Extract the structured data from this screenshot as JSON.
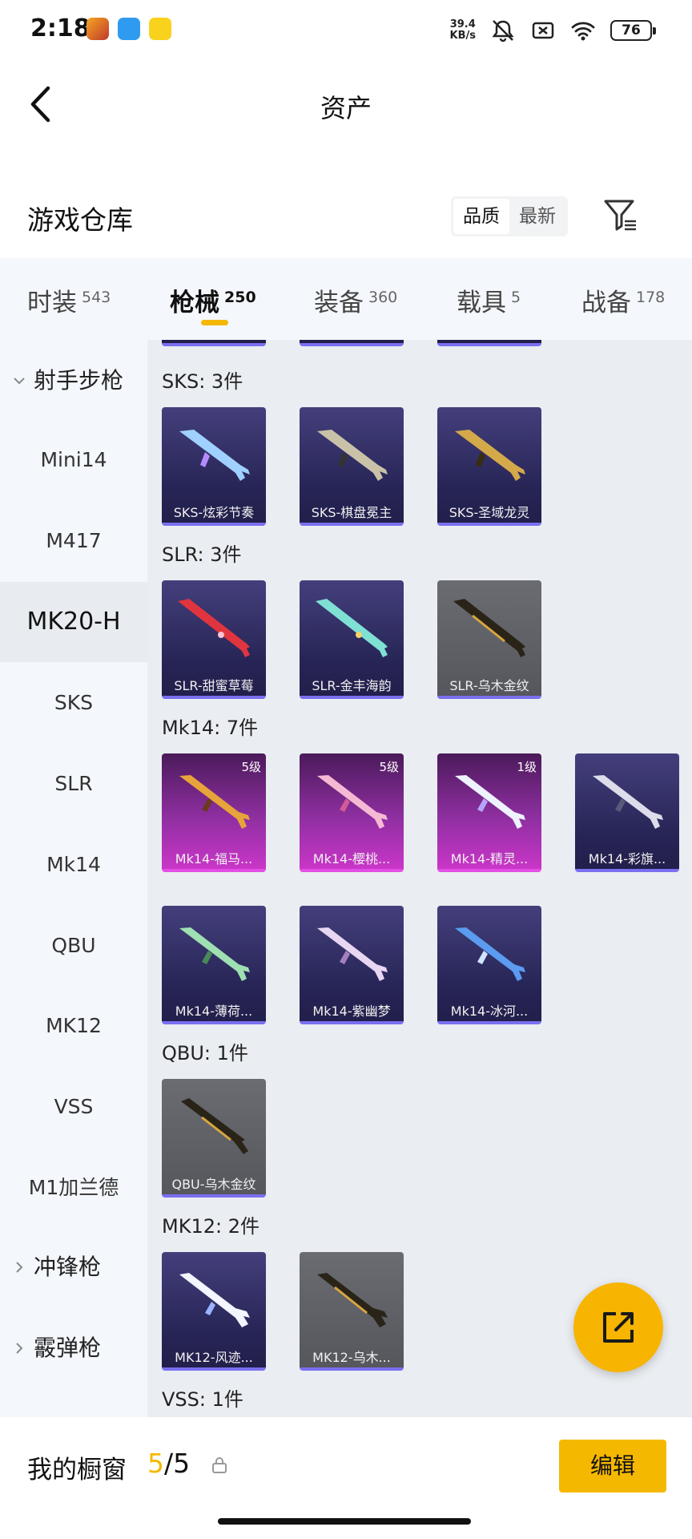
{
  "status": {
    "time": "2:18",
    "net_speed_value": "39.4",
    "net_speed_unit": "KB/s",
    "battery": "76"
  },
  "header": {
    "title": "资产"
  },
  "warehouse": {
    "title": "游戏仓库",
    "sort_quality": "品质",
    "sort_newest": "最新"
  },
  "tabs": [
    {
      "label": "时装",
      "count": "543"
    },
    {
      "label": "枪械",
      "count": "250"
    },
    {
      "label": "装备",
      "count": "360"
    },
    {
      "label": "载具",
      "count": "5"
    },
    {
      "label": "战备",
      "count": "178"
    }
  ],
  "sidebar": {
    "group_main": "射手步枪",
    "items": [
      "Mini14",
      "M417",
      "MK20-H",
      "SKS",
      "SLR",
      "Mk14",
      "QBU",
      "MK12",
      "VSS",
      "M1加兰德"
    ],
    "group_smg": "冲锋枪",
    "group_shotgun": "霰弹枪"
  },
  "groups": [
    {
      "label": "SKS: 3件",
      "items": [
        {
          "name": "SKS-炫彩节奏",
          "rarity": "purple"
        },
        {
          "name": "SKS-棋盘冕主",
          "rarity": "purple"
        },
        {
          "name": "SKS-圣域龙灵",
          "rarity": "purple"
        }
      ]
    },
    {
      "label": "SLR: 3件",
      "items": [
        {
          "name": "SLR-甜蜜草莓",
          "rarity": "purple"
        },
        {
          "name": "SLR-金丰海韵",
          "rarity": "purple"
        },
        {
          "name": "SLR-乌木金纹",
          "rarity": "gray"
        }
      ]
    },
    {
      "label": "Mk14: 7件",
      "items": [
        {
          "name": "Mk14-福马...",
          "rarity": "pink",
          "level": "5级"
        },
        {
          "name": "Mk14-樱桃...",
          "rarity": "pink",
          "level": "5级"
        },
        {
          "name": "Mk14-精灵...",
          "rarity": "pink",
          "level": "1级"
        },
        {
          "name": "Mk14-彩旗...",
          "rarity": "purple"
        },
        {
          "name": "Mk14-薄荷...",
          "rarity": "purple"
        },
        {
          "name": "Mk14-紫幽梦",
          "rarity": "purple"
        },
        {
          "name": "Mk14-冰河...",
          "rarity": "purple"
        }
      ]
    },
    {
      "label": "QBU: 1件",
      "items": [
        {
          "name": "QBU-乌木金纹",
          "rarity": "gray"
        }
      ]
    },
    {
      "label": "MK12: 2件",
      "items": [
        {
          "name": "MK12-风迹...",
          "rarity": "purple"
        },
        {
          "name": "MK12-乌木...",
          "rarity": "gray"
        }
      ]
    },
    {
      "label": "VSS: 1件",
      "items": []
    }
  ],
  "bottom": {
    "window_label": "我的橱窗",
    "window_current": "5",
    "window_total": "5",
    "edit_label": "编辑"
  },
  "colors": {
    "accent": "#f5b800",
    "purple_card": "#272556",
    "pink_card": "#c936c8",
    "gray_card": "#55575d"
  }
}
